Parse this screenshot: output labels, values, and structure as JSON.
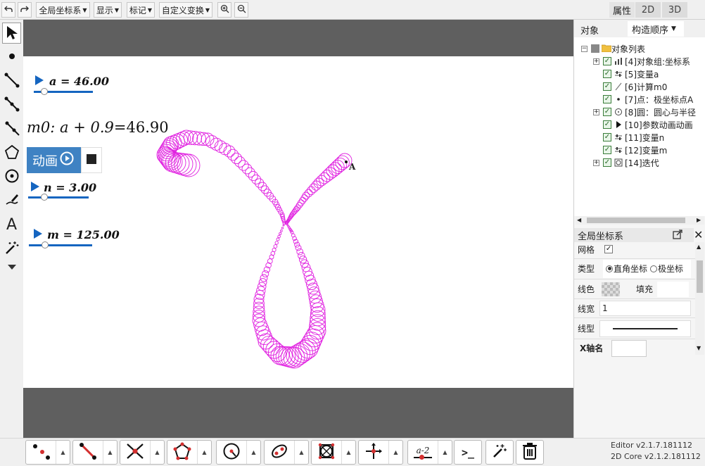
{
  "toolbar": {
    "undo_icon": "undo-icon",
    "redo_icon": "redo-icon",
    "menus": [
      "全局坐标系",
      "显示",
      "标记",
      "自定义变换"
    ],
    "zoom_in_icon": "zoom-in-icon",
    "zoom_out_icon": "zoom-out-icon",
    "view_tabs": [
      "属性",
      "2D",
      "3D"
    ]
  },
  "left_tools": [
    "select-arrow-icon",
    "point-icon",
    "segment-icon",
    "segment-points-icon",
    "ray-icon",
    "polygon-icon",
    "circle-icon",
    "freehand-icon",
    "text-icon",
    "magic-wand-icon",
    "more-icon"
  ],
  "canvas": {
    "slider_a": {
      "label": "a = 46.00",
      "value": 46.0
    },
    "formula": {
      "prefix": "m0: ",
      "expr": "a + 0.9",
      "eq": "=46.90"
    },
    "animation_button": "动画",
    "slider_n": {
      "label": "n = 3.00",
      "value": 3.0
    },
    "slider_m": {
      "label": "m = 125.00",
      "value": 125.0
    },
    "point_label": "A",
    "curve_color": "#e020e0"
  },
  "right_panel": {
    "tabs": [
      "对象",
      "构造顺序"
    ],
    "tree": {
      "root": "对象列表",
      "items": [
        {
          "label": "[4]对象组:坐标系",
          "icon": "chart-icon",
          "expandable": true
        },
        {
          "label": "[5]变量a",
          "icon": "slider-icon",
          "expandable": false
        },
        {
          "label": "[6]计算m0",
          "icon": "calc-icon",
          "expandable": false
        },
        {
          "label": "[7]点：极坐标点A",
          "icon": "point-icon",
          "expandable": false
        },
        {
          "label": "[8]圆：圆心与半径",
          "icon": "circle-icon",
          "expandable": true
        },
        {
          "label": "[10]参数动画动画",
          "icon": "play-icon",
          "expandable": false
        },
        {
          "label": "[11]变量n",
          "icon": "slider-icon",
          "expandable": false
        },
        {
          "label": "[12]变量m",
          "icon": "slider-icon",
          "expandable": false
        },
        {
          "label": "[14]迭代",
          "icon": "iterate-icon",
          "expandable": true
        }
      ]
    },
    "properties": {
      "title": "全局坐标系",
      "grid_label": "网格",
      "grid_checked": true,
      "type_label": "类型",
      "type_options": [
        "直角坐标",
        "极坐标"
      ],
      "type_selected": "直角坐标",
      "line_color_label": "线色",
      "fill_label": "填充",
      "line_width_label": "线宽",
      "line_width_value": "1",
      "line_style_label": "线型",
      "x_axis_name_label": "X轴名"
    }
  },
  "bottom_tools": [
    "point-tools-icon",
    "segment-tools-icon",
    "intersect-tools-icon",
    "polygon-tools-icon",
    "circle-tools-icon",
    "conic-tools-icon",
    "transform-tools-icon",
    "axis-tools-icon",
    "measure-tools-icon",
    "command-tools-icon",
    "magic-tools-icon",
    "trash-icon"
  ],
  "bottom_text": {
    "measure_label": "a-2",
    "command_label": ">_"
  },
  "version": {
    "editor": "Editor v2.1.7.181112",
    "core": "2D Core v2.1.2.181112"
  }
}
